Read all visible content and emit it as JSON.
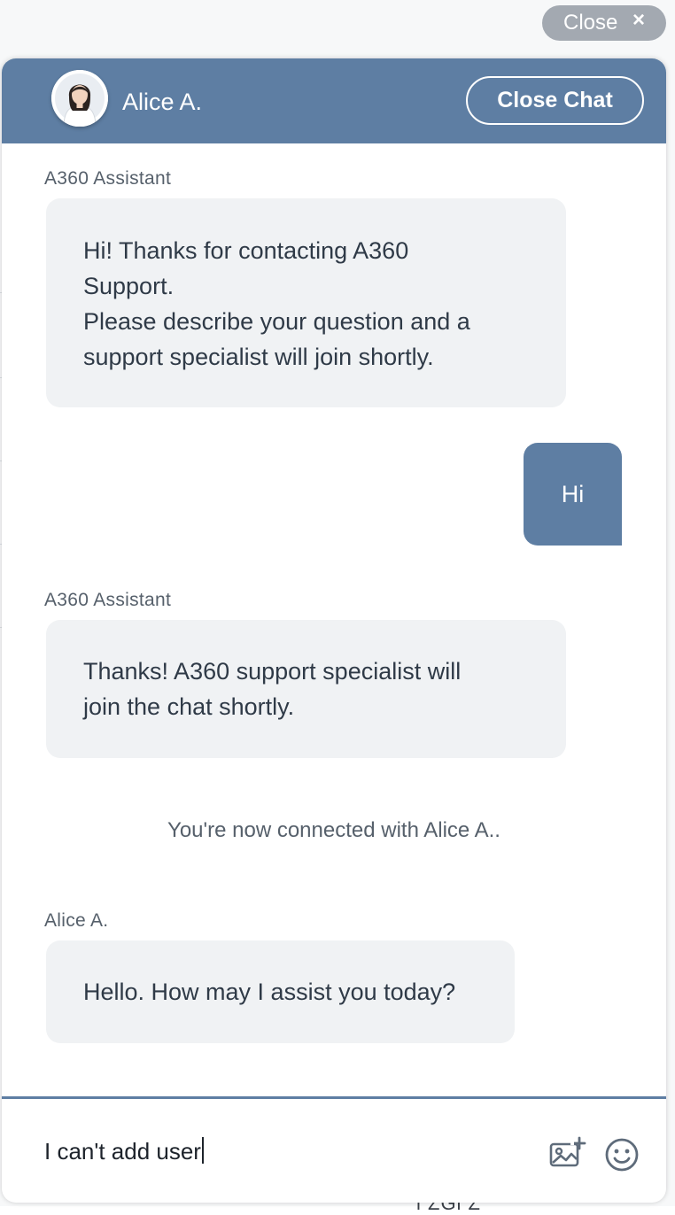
{
  "top_bar": {
    "close_label": "Close",
    "close_icon": "×"
  },
  "header": {
    "agent_name": "Alice A.",
    "close_chat_label": "Close Chat",
    "avatar_icon": "agent-avatar"
  },
  "messages": [
    {
      "sender": "A360 Assistant",
      "lines": [
        "Hi! Thanks for contacting A360",
        "Support.",
        "Please describe your question and a",
        "support specialist will join shortly."
      ]
    },
    {
      "sender": "user",
      "text": "Hi"
    },
    {
      "sender": "A360 Assistant",
      "lines": [
        "Thanks! A360 support specialist will",
        "join the chat shortly."
      ]
    },
    {
      "system": "You're now connected with Alice A.."
    },
    {
      "sender": "Alice A.",
      "lines": [
        "Hello. How may I assist you today?"
      ]
    }
  ],
  "composer": {
    "value": "I can't add user",
    "image_icon": "image-add-icon",
    "emoji_icon": "emoji-icon"
  },
  "background": {
    "peek_text": "l ZGl Z"
  },
  "colors": {
    "header": "#5e7ea3",
    "user_bubble": "#5e7ea3",
    "agent_bubble": "#f0f2f4",
    "top_close": "#a3a9b1"
  }
}
